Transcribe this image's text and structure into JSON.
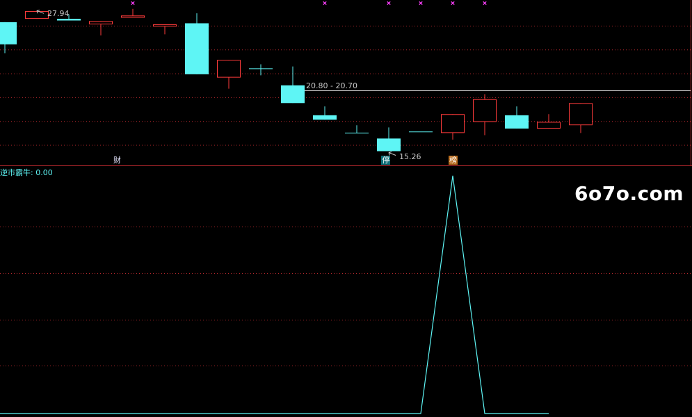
{
  "chart_data": [
    {
      "type": "candlestick",
      "candles": [
        {
          "open": 26.9,
          "close": 24.9,
          "high": null,
          "low": 24.1
        },
        {
          "open": 27.2,
          "close": 27.9,
          "high": 27.94,
          "low": null
        },
        {
          "open": 27.2,
          "close": 27.05,
          "high": 27.6,
          "low": null
        },
        {
          "open": 26.7,
          "close": 27.0,
          "high": null,
          "low": 25.7
        },
        {
          "open": 27.3,
          "close": 27.5,
          "high": 28.1,
          "low": null
        },
        {
          "open": 26.5,
          "close": 26.7,
          "high": null,
          "low": 25.8
        },
        {
          "open": 26.8,
          "close": 22.2,
          "high": 27.7,
          "low": null
        },
        {
          "open": 21.9,
          "close": 23.5,
          "high": null,
          "low": 20.9
        },
        {
          "open": 22.7,
          "close": 22.7,
          "high": 23.1,
          "low": 22.1
        },
        {
          "open": 21.2,
          "close": 19.6,
          "high": 22.9,
          "low": null
        },
        {
          "open": 18.5,
          "close": 18.1,
          "high": 19.3,
          "low": null
        },
        {
          "open": 16.9,
          "close": 16.9,
          "high": 17.6,
          "low": null
        },
        {
          "open": 16.4,
          "close": 15.26,
          "high": 17.4,
          "low": null
        },
        {
          "open": 17.0,
          "close": 17.0,
          "high": null,
          "low": null
        },
        {
          "open": 16.9,
          "close": 18.6,
          "high": null,
          "low": 16.3
        },
        {
          "open": 17.9,
          "close": 19.95,
          "high": 20.4,
          "low": 16.7
        },
        {
          "open": 18.5,
          "close": 17.3,
          "high": 19.3,
          "low": null
        },
        {
          "open": 17.3,
          "close": 17.9,
          "high": 18.6,
          "low": null
        },
        {
          "open": 17.6,
          "close": 19.6,
          "high": null,
          "low": 16.9
        }
      ],
      "ylim": [
        14.1,
        28.9
      ],
      "annotations": {
        "high_label": "27.94",
        "low_label": "15.26",
        "range_label": "20.80 - 20.70",
        "range_price": 20.75
      },
      "markers": [
        {
          "index": 4
        },
        {
          "index": 10
        },
        {
          "index": 12
        },
        {
          "index": 13
        },
        {
          "index": 14
        },
        {
          "index": 15
        }
      ],
      "event_tags": [
        {
          "index": 3.5,
          "text": "财",
          "style": "plain"
        },
        {
          "index": 11.9,
          "text": "停",
          "style": "teal"
        },
        {
          "index": 14,
          "text": "榜",
          "style": "orange"
        }
      ],
      "colors": {
        "up": "#ff3b3b",
        "down": "#5ef5f5",
        "marker": "#ff40ff",
        "grid": "#b4282d",
        "axis": "#b4282d",
        "range_line": "#c8c8c8"
      }
    },
    {
      "type": "line",
      "title": "逆市霸牛: 0.00",
      "series": [
        {
          "values": [
            0,
            0,
            0,
            0,
            0,
            0,
            0,
            0,
            0,
            0,
            0,
            0,
            0,
            0,
            1,
            0,
            0,
            0
          ]
        }
      ],
      "ylim": [
        0,
        1.02
      ],
      "colors": {
        "line": "#5ef5f5"
      }
    }
  ],
  "watermark": "6o7o.com"
}
